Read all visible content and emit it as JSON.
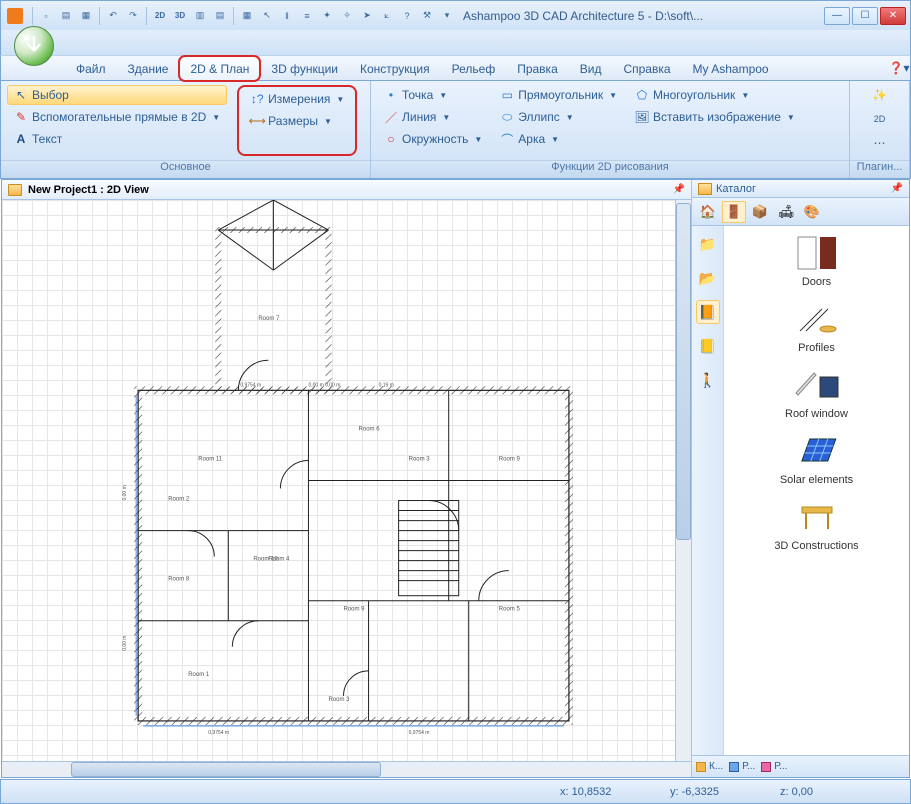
{
  "window": {
    "title": "Ashampoo 3D CAD Architecture 5 - D:\\soft\\..."
  },
  "tabs": {
    "file": "Файл",
    "building": "Здание",
    "plan2d": "2D & План",
    "func3d": "3D функции",
    "construction": "Конструкция",
    "relief": "Рельеф",
    "edit": "Правка",
    "view": "Вид",
    "help": "Справка",
    "myashampoo": "My Ashampoo"
  },
  "ribbon": {
    "select": "Выбор",
    "guides2d": "Вспомогательные прямые в 2D",
    "text": "Текст",
    "measurements": "Измерения",
    "dimensions": "Размеры",
    "group_main": "Основное",
    "point": "Точка",
    "line": "Линия",
    "circle": "Окружность",
    "rect": "Прямоугольник",
    "ellipse": "Эллипс",
    "arc": "Арка",
    "polygon": "Многоугольник",
    "insert_image": "Вставить изображение",
    "group_draw": "Функции 2D рисования",
    "plugins": "Плагин..."
  },
  "view_title": "New Project1 : 2D View",
  "rooms": {
    "r1": "Room 1",
    "r2": "Room 2",
    "r3": "Room 3",
    "r4": "Room 4",
    "r5": "Room 5",
    "r6": "Room 6",
    "r7": "Room 7",
    "r8": "Room 8",
    "r9a": "Room 9",
    "r9b": "Room 9",
    "r10": "Room 10",
    "r11": "Room 11"
  },
  "dims": {
    "d1": "0,00 m 0,00 m",
    "d2": "0,19 m",
    "d3": "0,9754 m",
    "d4": "0,9754 m",
    "d5": "0,9754 m",
    "d6": "0,00 m",
    "d7": "0,00 m"
  },
  "catalog": {
    "title": "Каталог",
    "items": {
      "doors": "Doors",
      "profiles": "Profiles",
      "roofwindow": "Roof window",
      "solar": "Solar elements",
      "constr3d": "3D Constructions"
    },
    "tabs": {
      "k": "К...",
      "p1": "Р...",
      "p2": "Р..."
    }
  },
  "status": {
    "x_label": "x:",
    "x": "10,8532",
    "y_label": "y:",
    "y": "-6,3325",
    "z_label": "z:",
    "z": "0,00"
  }
}
